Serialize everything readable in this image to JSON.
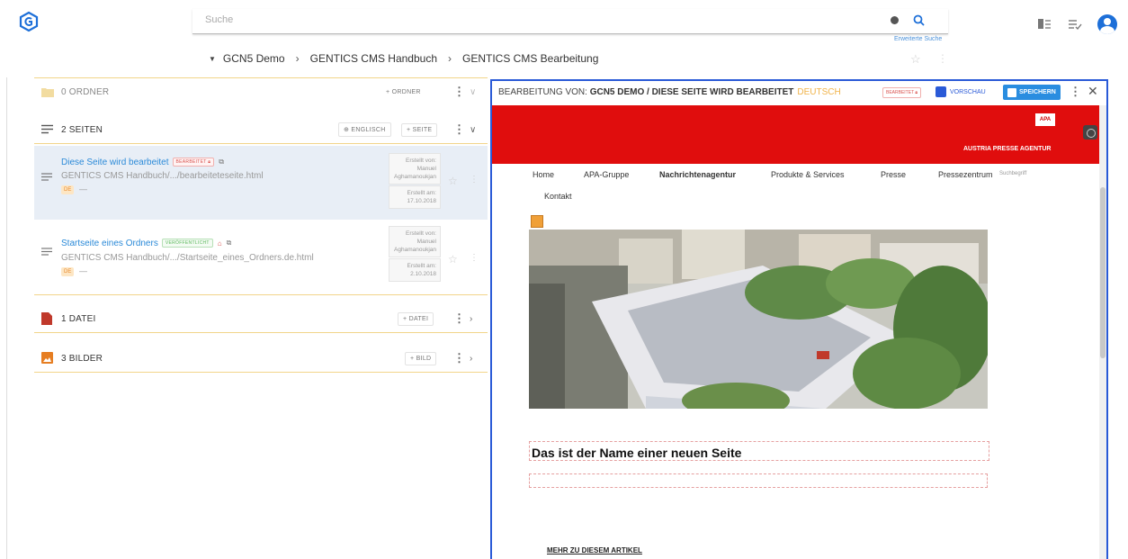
{
  "search": {
    "placeholder": "Suche",
    "advanced_label": "Erweiterte Suche"
  },
  "breadcrumb": {
    "items": [
      "GCN5 Demo",
      "GENTICS CMS Handbuch",
      "GENTICS CMS Bearbeitung"
    ]
  },
  "left": {
    "folders": {
      "title": "0 ORDNER",
      "add_label": "+ ORDNER"
    },
    "pages": {
      "title": "2 SEITEN",
      "lang_label": "ENGLISCH",
      "add_label": "+ SEITE",
      "items": [
        {
          "title": "Diese Seite wird bearbeitet",
          "badge": "BEARBEITET",
          "path": "GENTICS CMS Handbuch/.../bearbeiteteseite.html",
          "lang": "DE",
          "dash": "—",
          "created_by_label": "Erstellt von:",
          "created_by_first": "Manuel",
          "created_by_last": "Aghamanoukjan",
          "created_at_label": "Erstellt am:",
          "created_at": "17.10.2018"
        },
        {
          "title": "Startseite eines Ordners",
          "badge": "VERÖFFENTLICHT",
          "path": "GENTICS CMS Handbuch/.../Startseite_eines_Ordners.de.html",
          "lang": "DE",
          "dash": "—",
          "created_by_label": "Erstellt von:",
          "created_by_first": "Manuel",
          "created_by_last": "Aghamanoukjan",
          "created_at_label": "Erstellt am:",
          "created_at": "2.10.2018"
        }
      ]
    },
    "files": {
      "title": "1 DATEI",
      "add_label": "+ DATEI"
    },
    "images": {
      "title": "3 BILDER",
      "add_label": "+ BILD"
    }
  },
  "editor": {
    "title_prefix": "BEARBEITUNG VON:",
    "title_main": "GCN5 DEMO / DIESE SEITE WIRD BEARBEITET",
    "language": "DEUTSCH",
    "badge": "BEARBEITET",
    "preview_label": "VORSCHAU",
    "save_label": "SPEICHERN",
    "close_glyph": "✕"
  },
  "site": {
    "logo_text": "APA",
    "agency_name": "AUSTRIA PRESSE AGENTUR",
    "nav": [
      "Home",
      "APA-Gruppe",
      "Nachrichtenagentur",
      "Produkte & Services",
      "Presse",
      "Pressezentrum"
    ],
    "nav_search": "Suchbegriff",
    "nav_second": "Kontakt",
    "headline": "Das ist der Name einer neuen Seite",
    "more_link": "MEHR ZU DIESEM ARTIKEL"
  },
  "colors": {
    "accent": "#2a5ad7",
    "site_red": "#e00d0d",
    "link_blue": "#2b8ad8",
    "folder_yellow": "#f2d58a"
  }
}
